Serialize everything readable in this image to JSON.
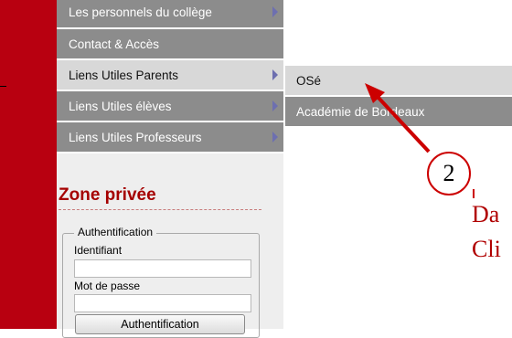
{
  "menu": {
    "items": [
      {
        "label": "Les personnels du collège"
      },
      {
        "label": "Contact & Accès"
      },
      {
        "label": "Liens Utiles Parents"
      },
      {
        "label": "Liens Utiles élèves"
      },
      {
        "label": "Liens Utiles Professeurs"
      }
    ],
    "active_index": 2
  },
  "submenu": {
    "items": [
      {
        "label": "OSé"
      },
      {
        "label": "Académie de Bordeaux"
      }
    ]
  },
  "private_zone": {
    "title": "Zone privée",
    "legend": "Authentification",
    "username_label": "Identifiant",
    "password_label": "Mot de passe",
    "submit_label": "Authentification"
  },
  "annotation": {
    "number": "2",
    "text_line1": "Da",
    "text_line2": "Cli"
  },
  "colors": {
    "accent_red": "#b80010",
    "menu_gray": "#8c8c8c",
    "menu_active": "#d8d8d8",
    "annotation_red": "#cc0000"
  }
}
